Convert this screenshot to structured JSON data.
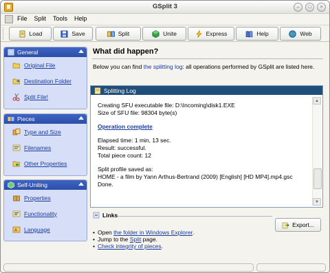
{
  "window": {
    "title": "GSplit 3"
  },
  "menu": {
    "items": [
      "File",
      "Split",
      "Tools",
      "Help"
    ]
  },
  "toolbar": {
    "buttons": [
      {
        "label": "Load",
        "icon": "load-icon"
      },
      {
        "label": "Save",
        "icon": "save-icon"
      },
      {
        "label": "Split",
        "icon": "split-icon"
      },
      {
        "label": "Unite",
        "icon": "unite-icon"
      },
      {
        "label": "Express",
        "icon": "express-icon"
      },
      {
        "label": "Help",
        "icon": "help-icon"
      },
      {
        "label": "Web",
        "icon": "web-icon"
      }
    ]
  },
  "sidebar": {
    "general": {
      "title": "General",
      "items": [
        "Original File",
        "Destination Folder",
        "Split File!"
      ]
    },
    "pieces": {
      "title": "Pieces",
      "items": [
        "Type and Size",
        "Filenames",
        "Other Properties"
      ]
    },
    "self_uniting": {
      "title": "Self-Uniting",
      "items": [
        "Properties",
        "Functionality",
        "Language"
      ]
    }
  },
  "main": {
    "title": "What did happen?",
    "intro_prefix": "Below you can find ",
    "intro_highlight": "the splitting log",
    "intro_suffix": ": all operations performed by GSplit are listed here.",
    "log": {
      "title": "Splitting Log",
      "line1": "Creating SFU executable file: D:\\Incoming\\disk1.EXE",
      "line2": "Size of SFU file: 98304 byte(s)",
      "op_complete": "Operation complete",
      "elapsed": "Elapsed time: 1 min, 13 sec.",
      "result": "Result: successful.",
      "total": "Total piece count: 12",
      "profile1": "Split profile saved as:",
      "profile2": "HOME - a film by Yann Arthus-Bertrand (2009) [English] [HD MP4].mp4.gsc",
      "done": "Done."
    },
    "links": {
      "title": "Links",
      "export_label": "Export...",
      "l1_prefix": "Open ",
      "l1_link": "the folder in Windows Explorer",
      "l1_suffix": ".",
      "l2_prefix": "Jump to the ",
      "l2_link": "Split",
      "l2_suffix": " page.",
      "l3_link": "Check integrity of pieces",
      "l3_suffix": ".",
      "bullet": "•"
    }
  },
  "colors": {
    "panel_header": "#2c4fa8",
    "panel_bg": "#d6dff7",
    "log_header": "#1f4e7a",
    "link": "#1a3aa0"
  }
}
